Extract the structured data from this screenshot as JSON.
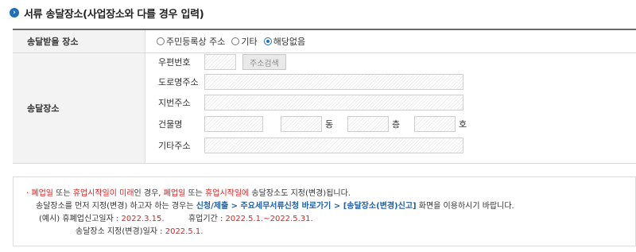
{
  "section": {
    "title": "서류 송달장소(사업장소와 다를 경우 입력)"
  },
  "place_row": {
    "label": "송달받을 장소",
    "options": [
      {
        "label": "주민등록상 주소",
        "checked": false
      },
      {
        "label": "기타",
        "checked": false
      },
      {
        "label": "해당없음",
        "checked": true
      }
    ]
  },
  "address": {
    "label": "송달장소",
    "postcode_label": "우편번호",
    "search_button": "주소검색",
    "road_label": "도로명주소",
    "lot_label": "지번주소",
    "building_label": "건물명",
    "dong_unit": "동",
    "floor_unit": "층",
    "ho_unit": "호",
    "other_label": "기타주소"
  },
  "notice": {
    "l1_a": "폐업일",
    "l1_b": " 또는 ",
    "l1_c": "휴업시작일이 미래",
    "l1_d": "인 경우, ",
    "l1_e": "폐업일",
    "l1_f": " 또는 ",
    "l1_g": "휴업시작일에",
    "l1_h": " 송달장소도 지정(변경)됩니다.",
    "l2_a": "송달장소를 먼저 지정(변경) 하고자 하는 경우는 ",
    "l2_b": "신청/제출 > 주요세무서류신청 바로가기 > [송달장소(변경)신고]",
    "l2_c": " 화면을 이용하시기 바랍니다.",
    "l3_a": "(예시) 휴폐업신고일자 : ",
    "l3_b": "2022.3.15.",
    "l3_c": "휴업기간 : ",
    "l3_d": "2022.5.1.~2022.5.31.",
    "l4_a": "송달장소 지정(변경)일자 : ",
    "l4_b": "2022.5.1."
  },
  "colors": {
    "accent": "#1f6fb8",
    "warning": "#e02020",
    "link": "#1f5fa8"
  }
}
